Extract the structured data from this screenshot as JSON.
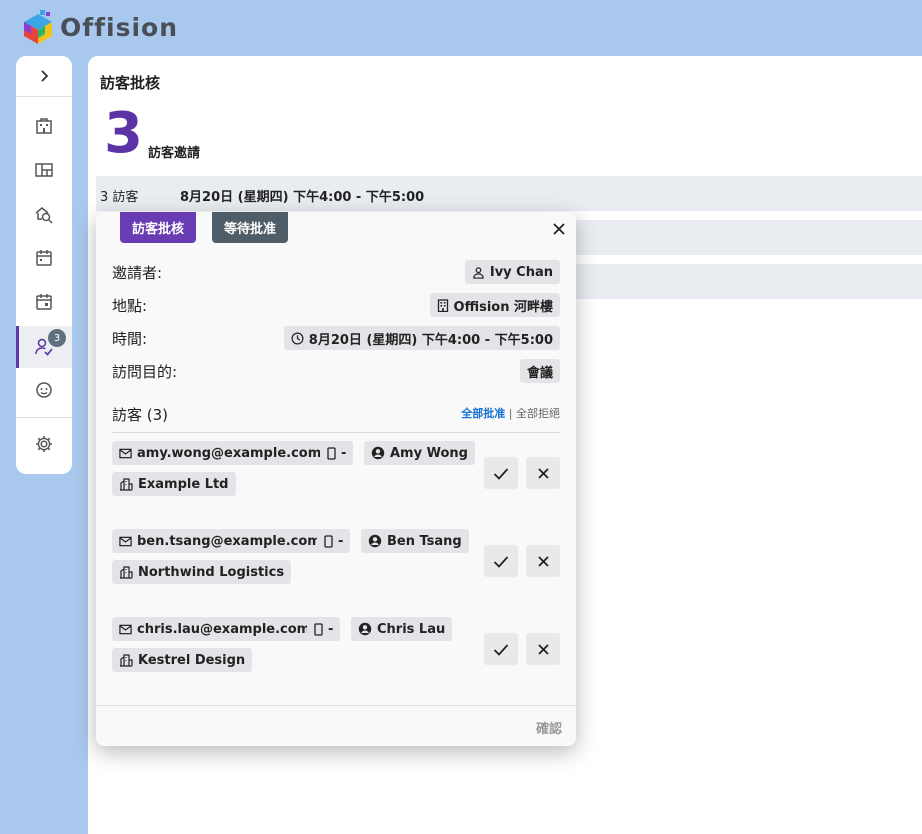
{
  "app": {
    "name": "Offision"
  },
  "sidebar": {
    "badge_count": "3"
  },
  "page": {
    "title": "訪客批核",
    "count": "3",
    "count_label": "訪客邀請",
    "rows": [
      {
        "visitors": "3 訪客",
        "time": "8月20日 (星期四) 下午4:00 - 下午5:00"
      }
    ]
  },
  "popup": {
    "tab_approve": "訪客批核",
    "tab_pending": "等待批准",
    "fields": {
      "inviter_label": "邀請者:",
      "inviter_value": "Ivy Chan",
      "location_label": "地點:",
      "location_value": "Offision 河畔樓",
      "time_label": "時間:",
      "time_value": "8月20日 (星期四) 下午4:00 - 下午5:00",
      "purpose_label": "訪問目的:",
      "purpose_value": "會議"
    },
    "visitors_heading": "訪客 (3)",
    "approve_all": "全部批准",
    "divider": "|",
    "reject_all": "全部拒絕",
    "visitors": [
      {
        "email": "amy.wong@example.com",
        "phone": "-",
        "name": "Amy Wong",
        "company": "Example Ltd"
      },
      {
        "email": "ben.tsang@example.com",
        "phone": "-",
        "name": "Ben Tsang",
        "company": "Northwind Logistics"
      },
      {
        "email": "chris.lau@example.com",
        "phone": "-",
        "name": "Chris Lau",
        "company": "Kestrel Design"
      }
    ],
    "confirm": "確認"
  },
  "colors": {
    "accent": "#5b33a6",
    "pending": "#4f5d68",
    "link": "#1673d4"
  }
}
